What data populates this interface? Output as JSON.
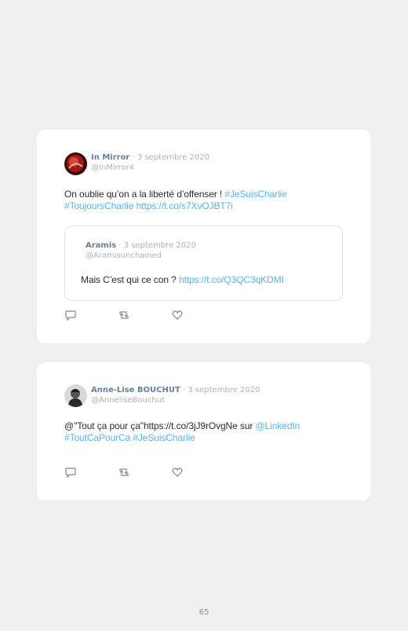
{
  "tweets": [
    {
      "name": "In Mirror",
      "date": "· 3 septembre 2020",
      "handle": "@InMirror4",
      "text_plain": "On oublie qu’on a la liberté d’offenser ! ",
      "hashtag1": "#JeSuisCharlie",
      "hashtag2": "#ToujoursCharlie",
      "url": "https://t.co/s7XvOJBT7i",
      "avatar_icon": "avatar-red-photo",
      "quoted": {
        "name": "Aramis",
        "date": "· 3 septembre 2020",
        "handle": "@Aramisunchained",
        "text_plain": "Mais C’est qui ce con ? ",
        "url": "https://t.co/Q3QC3qKDMI"
      }
    },
    {
      "name": "Anne-Lise BOUCHUT",
      "date": "· 3 septembre 2020",
      "handle": "@AnneliseBouchut",
      "text_plain": "@\"Tout ça pour ça\"https://t.co/3jJ9rOvgNe sur ",
      "mention": "@LinkedIn",
      "hashtag1": "#ToutCaPourCa",
      "hashtag2": "#JeSuisCharlie",
      "avatar_icon": "avatar-grey-photo"
    }
  ],
  "icons": [
    "reply-icon",
    "retweet-icon",
    "like-icon"
  ],
  "colors": {
    "link": "#56b3e6",
    "name": "#6a7f96",
    "meta": "#a9b2bb",
    "background": "#efefef"
  },
  "page_number": "65"
}
